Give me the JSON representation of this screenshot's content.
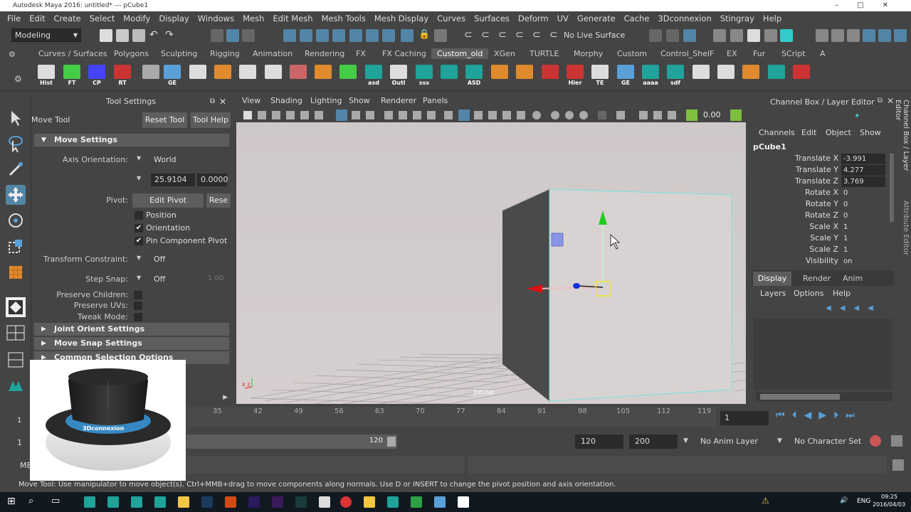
{
  "window": {
    "title": "Autodesk Maya 2016: untitled*  ---  pCube1"
  },
  "menu": [
    "File",
    "Edit",
    "Create",
    "Select",
    "Modify",
    "Display",
    "Windows",
    "Mesh",
    "Edit Mesh",
    "Mesh Tools",
    "Mesh Display",
    "Curves",
    "Surfaces",
    "Deform",
    "UV",
    "Generate",
    "Cache",
    "3Dconnexion",
    "Stingray",
    "Help"
  ],
  "status_line": {
    "mode": "Modeling",
    "live_surface": "No Live Surface"
  },
  "shelf_tabs": [
    "Curves / Surfaces",
    "Polygons",
    "Sculpting",
    "Rigging",
    "Animation",
    "Rendering",
    "FX",
    "FX Caching",
    "Custom_old",
    "XGen",
    "TURTLE",
    "Morphy",
    "Custom",
    "Control_ShelF",
    "EX",
    "Fur",
    "SCript",
    "A"
  ],
  "shelf_active_tab": "Custom_old",
  "shelf_items": [
    {
      "label": "Hist",
      "icon": "history-icon"
    },
    {
      "label": "FT",
      "icon": "freeze-transform-icon"
    },
    {
      "label": "CP",
      "icon": "center-pivot-icon"
    },
    {
      "label": "RT",
      "icon": "reset-transform-icon"
    },
    {
      "label": "",
      "icon": "delete-icon"
    },
    {
      "label": "GE",
      "icon": "graph-editor-icon"
    },
    {
      "label": "",
      "icon": "skeleton-icon"
    },
    {
      "label": "",
      "icon": "cubes-icon"
    },
    {
      "label": "",
      "icon": "grid-icon"
    },
    {
      "label": "",
      "icon": "paint-icon"
    },
    {
      "label": "",
      "icon": "character-icon"
    },
    {
      "label": "",
      "icon": "sculpt-icon"
    },
    {
      "label": "",
      "icon": "checker-icon"
    },
    {
      "label": "asd",
      "icon": "script-icon"
    },
    {
      "label": "Outl",
      "icon": "outliner-icon"
    },
    {
      "label": "sss",
      "icon": "script-icon"
    },
    {
      "label": "",
      "icon": "script-icon"
    },
    {
      "label": "ASD",
      "icon": "script-icon"
    },
    {
      "label": "",
      "icon": "cubes-icon"
    },
    {
      "label": "",
      "icon": "cube-orange-icon"
    },
    {
      "label": "",
      "icon": "joint-icon"
    },
    {
      "label": "Hier",
      "icon": "hierarchy-icon"
    },
    {
      "label": "TE",
      "icon": "text-editor-icon"
    },
    {
      "label": "GE",
      "icon": "graph-editor-icon"
    },
    {
      "label": "aaaa",
      "icon": "script-icon"
    },
    {
      "label": "sdf",
      "icon": "script-icon"
    },
    {
      "label": "",
      "icon": "camera-icon"
    },
    {
      "label": "",
      "icon": "camera-icon"
    },
    {
      "label": "",
      "icon": "cubes-icon"
    },
    {
      "label": "",
      "icon": "script-icon"
    },
    {
      "label": "",
      "icon": "bend-icon"
    }
  ],
  "tool_settings": {
    "header": "Tool Settings",
    "tool_name": "Move Tool",
    "reset_button": "Reset Tool",
    "help_button": "Tool Help",
    "move_settings": "Move Settings",
    "axis_orientation_label": "Axis Orientation:",
    "axis_orientation_value": "World",
    "value1": "25.9104",
    "value2": "0.0000",
    "pivot_label": "Pivot:",
    "edit_pivot": "Edit Pivot",
    "reset_pivot": "Rese",
    "position": "Position",
    "orientation": "Orientation",
    "pin_component_pivot": "Pin Component Pivot",
    "transform_constraint_label": "Transform Constraint:",
    "transform_constraint_value": "Off",
    "step_snap_label": "Step Snap:",
    "step_snap_value": "Off",
    "step_snap_amount": "1.00",
    "preserve_children": "Preserve Children:",
    "preserve_uvs": "Preserve UVs:",
    "tweak_mode": "Tweak Mode:",
    "joint_orient": "Joint Orient Settings",
    "move_snap": "Move Snap Settings",
    "common_selection": "Common Selection Options"
  },
  "viewport": {
    "menu": [
      "View",
      "Shading",
      "Lighting",
      "Show",
      "Renderer",
      "Panels"
    ],
    "time_value": "0.00",
    "camera_label": "persp"
  },
  "channel_box": {
    "header": "Channel Box / Layer Editor",
    "menu": [
      "Channels",
      "Edit",
      "Object",
      "Show"
    ],
    "object": "pCube1",
    "attributes": [
      {
        "name": "Translate X",
        "value": "-3.991"
      },
      {
        "name": "Translate Y",
        "value": "4.277"
      },
      {
        "name": "Translate Z",
        "value": "3.769"
      },
      {
        "name": "Rotate X",
        "value": "0"
      },
      {
        "name": "Rotate Y",
        "value": "0"
      },
      {
        "name": "Rotate Z",
        "value": "0"
      },
      {
        "name": "Scale X",
        "value": "1"
      },
      {
        "name": "Scale Y",
        "value": "1"
      },
      {
        "name": "Scale Z",
        "value": "1"
      },
      {
        "name": "Visibility",
        "value": "on"
      }
    ],
    "layer_tabs": [
      "Display",
      "Render",
      "Anim"
    ],
    "layer_menu": [
      "Layers",
      "Options",
      "Help"
    ],
    "side_tab_1": "Channel Box / Layer Editor",
    "side_tab_2": "Attribute Editor"
  },
  "time_slider": {
    "ticks": [
      "35",
      "42",
      "49",
      "56",
      "63",
      "70",
      "77",
      "84",
      "91",
      "98",
      "105",
      "112",
      "119"
    ],
    "start_frame": "1",
    "current_frame": "1"
  },
  "range_slider": {
    "start": "1",
    "range_end": "120",
    "end_field": "120",
    "max_field": "200",
    "anim_layer": "No Anim Layer",
    "character_set": "No Character Set"
  },
  "command_line": {
    "label": "ME"
  },
  "help_line": "Move Tool: Use manipulator to move object(s). Ctrl+MMB+drag to move components along normals. Use D or INSERT to change the pivot position and axis orientation.",
  "overlay": {
    "brand": "3Dconnexion"
  },
  "taskbar": {
    "language": "ENG",
    "time": "09:25",
    "date": "2016/04/03"
  },
  "colors": {
    "accent": "#5285a6",
    "panel": "#444444",
    "field": "#2b2b2b",
    "viewport": "#cccccc"
  }
}
